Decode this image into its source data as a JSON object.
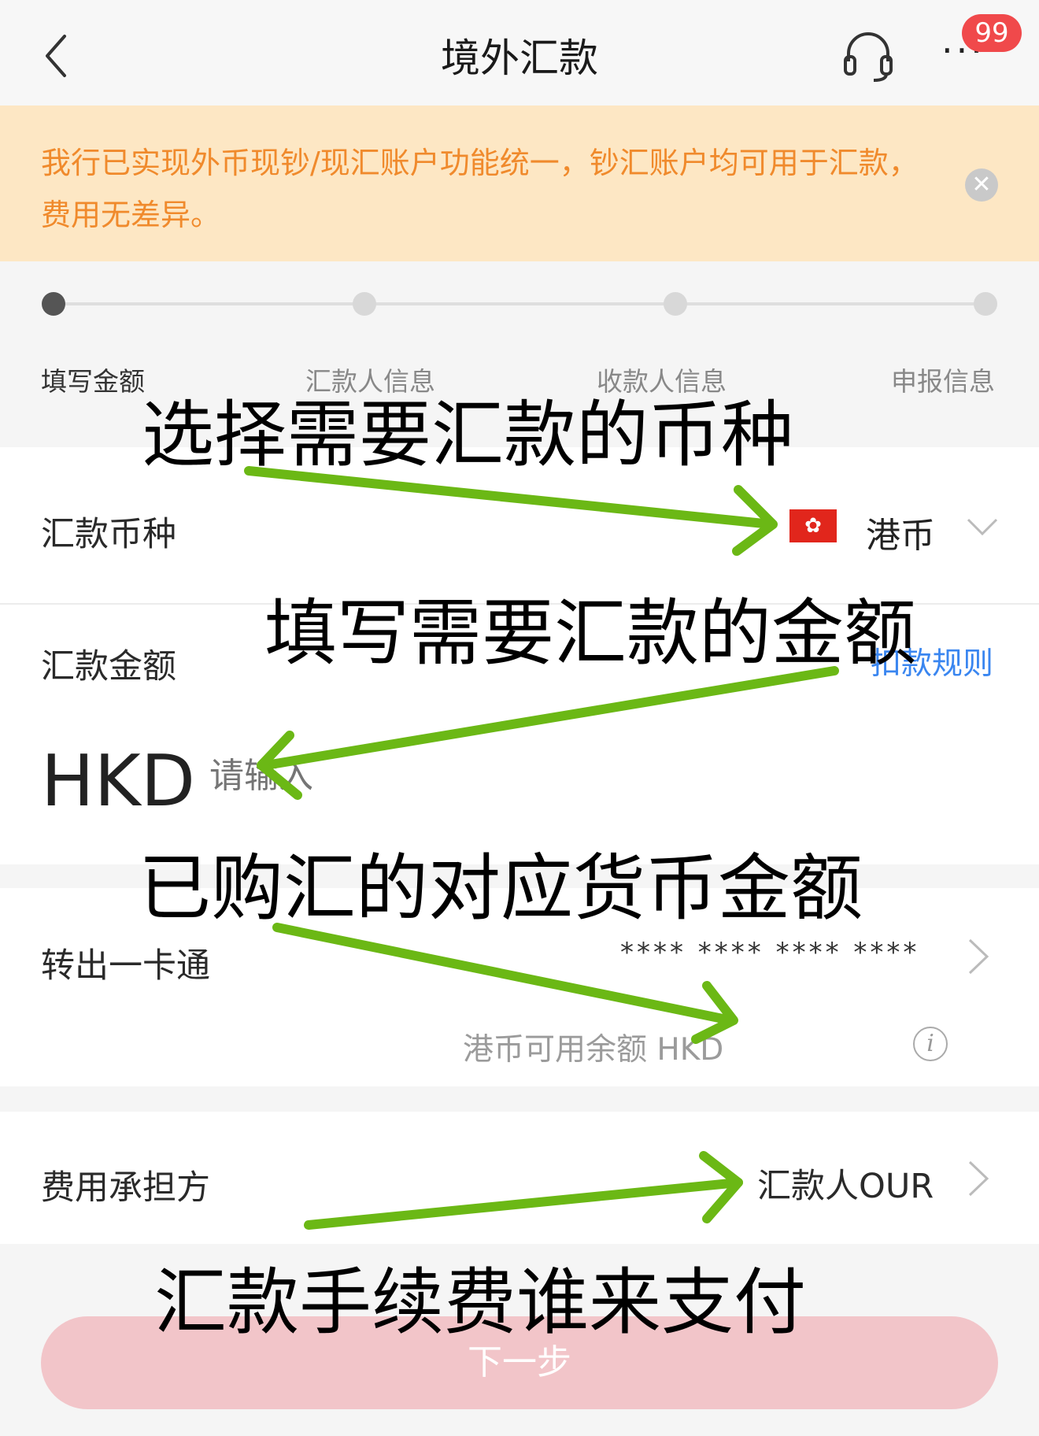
{
  "header": {
    "title": "境外汇款",
    "badge": "99",
    "more": "···"
  },
  "notice": {
    "text": "我行已实现外币现钞/现汇账户功能统一，钞汇账户均可用于汇款，费用无差异。",
    "close": "✕"
  },
  "steps": [
    {
      "label": "填写金额",
      "active": true
    },
    {
      "label": "汇款人信息",
      "active": false
    },
    {
      "label": "收款人信息",
      "active": false
    },
    {
      "label": "申报信息",
      "active": false
    }
  ],
  "currency_row": {
    "label": "汇款币种",
    "flag": "✿",
    "value": "港币"
  },
  "amount_row": {
    "label": "汇款金额",
    "rules_link": "扣款规则",
    "currency_code": "HKD",
    "placeholder": "请输入"
  },
  "account_row": {
    "label": "转出一卡通",
    "card_number": "**** **** **** ****",
    "balance": "港币可用余额 HKD",
    "info": "i"
  },
  "fee_row": {
    "label": "费用承担方",
    "value": "汇款人OUR"
  },
  "next_button": "下一步",
  "annotations": {
    "select_currency": "选择需要汇款的币种",
    "fill_amount": "填写需要汇款的金额",
    "purchased_amount": "已购汇的对应货币金额",
    "fee_payer": "汇款手续费谁来支付"
  },
  "colors": {
    "notice_bg": "#fde7c4",
    "notice_text": "#f08a2c",
    "link": "#3a86f0",
    "badge": "#f0494b",
    "button": "#f2c5c9",
    "arrow": "#6bb815"
  }
}
